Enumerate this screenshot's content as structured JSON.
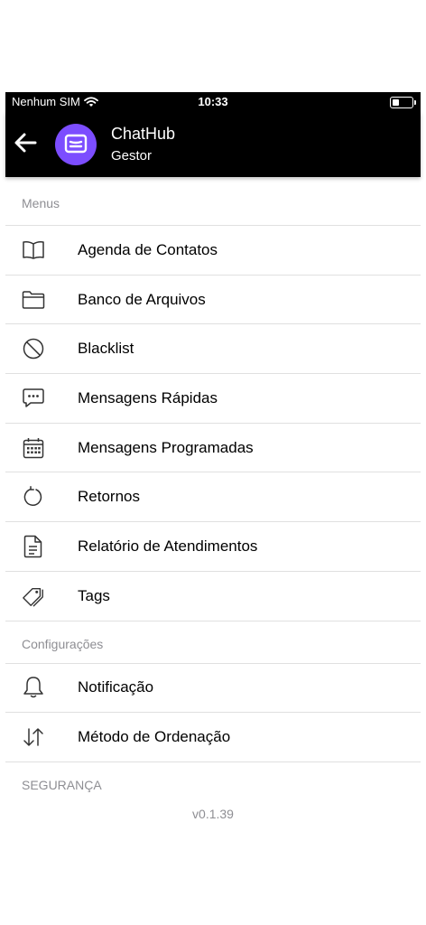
{
  "status_bar": {
    "carrier": "Nenhum SIM",
    "time": "10:33",
    "battery_level": 0.35
  },
  "header": {
    "title": "ChatHub",
    "subtitle": "Gestor",
    "avatar_color": "#7c4dff"
  },
  "sections": {
    "menus": "Menus",
    "configuracoes": "Configurações",
    "seguranca": "SEGURANÇA"
  },
  "menu_items": [
    {
      "label": "Agenda de Contatos",
      "icon": "book-icon"
    },
    {
      "label": "Banco de Arquivos",
      "icon": "folder-icon"
    },
    {
      "label": "Blacklist",
      "icon": "block-icon"
    },
    {
      "label": "Mensagens Rápidas",
      "icon": "chat-bubble-icon"
    },
    {
      "label": "Mensagens Programadas",
      "icon": "calendar-icon"
    },
    {
      "label": "Retornos",
      "icon": "refresh-icon"
    },
    {
      "label": "Relatório de Atendimentos",
      "icon": "document-icon"
    },
    {
      "label": "Tags",
      "icon": "tags-icon"
    }
  ],
  "config_items": [
    {
      "label": "Notificação",
      "icon": "bell-icon"
    },
    {
      "label": "Método de Ordenação",
      "icon": "sort-arrows-icon"
    }
  ],
  "version": "v0.1.39"
}
